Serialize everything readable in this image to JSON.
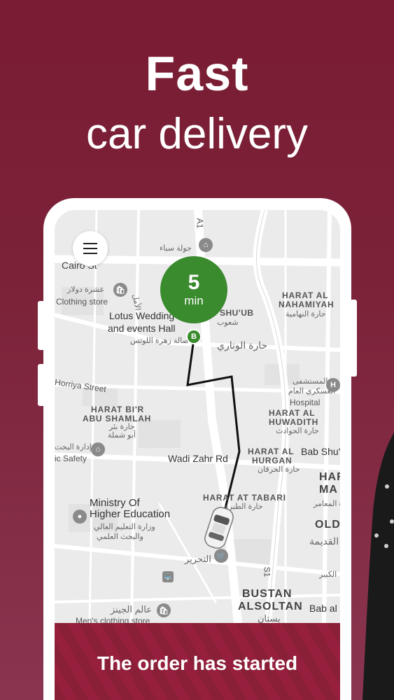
{
  "headline": {
    "line1": "Fast",
    "line2": "car delivery"
  },
  "map": {
    "eta": {
      "value": "5",
      "unit": "min"
    },
    "destination_marker": "B",
    "labels": {
      "a1": "A1",
      "jawlat": "جولة سباء",
      "cairo_st": "Cairo St",
      "clothing_ar": "عشرة دولار",
      "clothing_en": "Clothing store",
      "alamal": "الأمل",
      "lotus1": "Lotus Wedding",
      "lotus2": "and events Hall",
      "lotus_ar": "صالة زهرة اللوتس",
      "shuub": "SHU'UB",
      "shuub_ar": "شعوب",
      "harat_nahamiyah1": "HARAT AL",
      "harat_nahamiyah2": "NAHAMIYAH",
      "harat_nahamiyah_ar": "حارة النهامية",
      "wataari_ar": "حارة الوتاري",
      "hospital_ar1": "المستشفى",
      "hospital_ar2": "العسكري العام",
      "hospital_en": "Hospital",
      "horriya": "Horriya Street",
      "abu_shamlah1": "HARAT BI'R",
      "abu_shamlah2": "ABU SHAMLAH",
      "abu_shamlah_ar1": "حارة بئر",
      "abu_shamlah_ar2": "أبو شملة",
      "huwadith1": "HARAT AL",
      "huwadith2": "HUWADITH",
      "huwadith_ar": "حارة الحوادث",
      "safety_ar": "إدارة البحث",
      "safety_en": "ic Safety",
      "wadi_zahr": "Wadi Zahr Rd",
      "hurgan1": "HARAT AL",
      "hurgan2": "HURGAN",
      "hurgan_ar": "حارة الحرقان",
      "bab_shua": "Bab Shu'a",
      "har_ma1": "HAR",
      "har_ma2": "MA",
      "ma_ar": "حارة المعامر",
      "at_tabari": "HARAT AT TABARI",
      "at_tabari_ar": "حارة الطبري",
      "ministry1": "Ministry Of",
      "ministry2": "Higher Education",
      "ministry_ar1": "وزارة التعليم العالي",
      "ministry_ar2": "والبحث العلمي",
      "old": "OLD",
      "old_ar": "القديمة",
      "tahrir_ar": "التحرير",
      "kabir_ar": "الكبير",
      "s1": "S1",
      "bustan1": "BUSTAN",
      "bustan2": "ALSOLTAN",
      "bustan_ar": "بستان",
      "bab_al": "Bab al",
      "jeans_ar": "عالم الجينز",
      "mens_store": "Men's clothing store"
    }
  },
  "banner": {
    "status_text": "The order has started"
  },
  "colors": {
    "background": "#7a1c33",
    "eta_badge": "#3a8a2e",
    "banner": "#8a1f38",
    "route": "#111111"
  }
}
